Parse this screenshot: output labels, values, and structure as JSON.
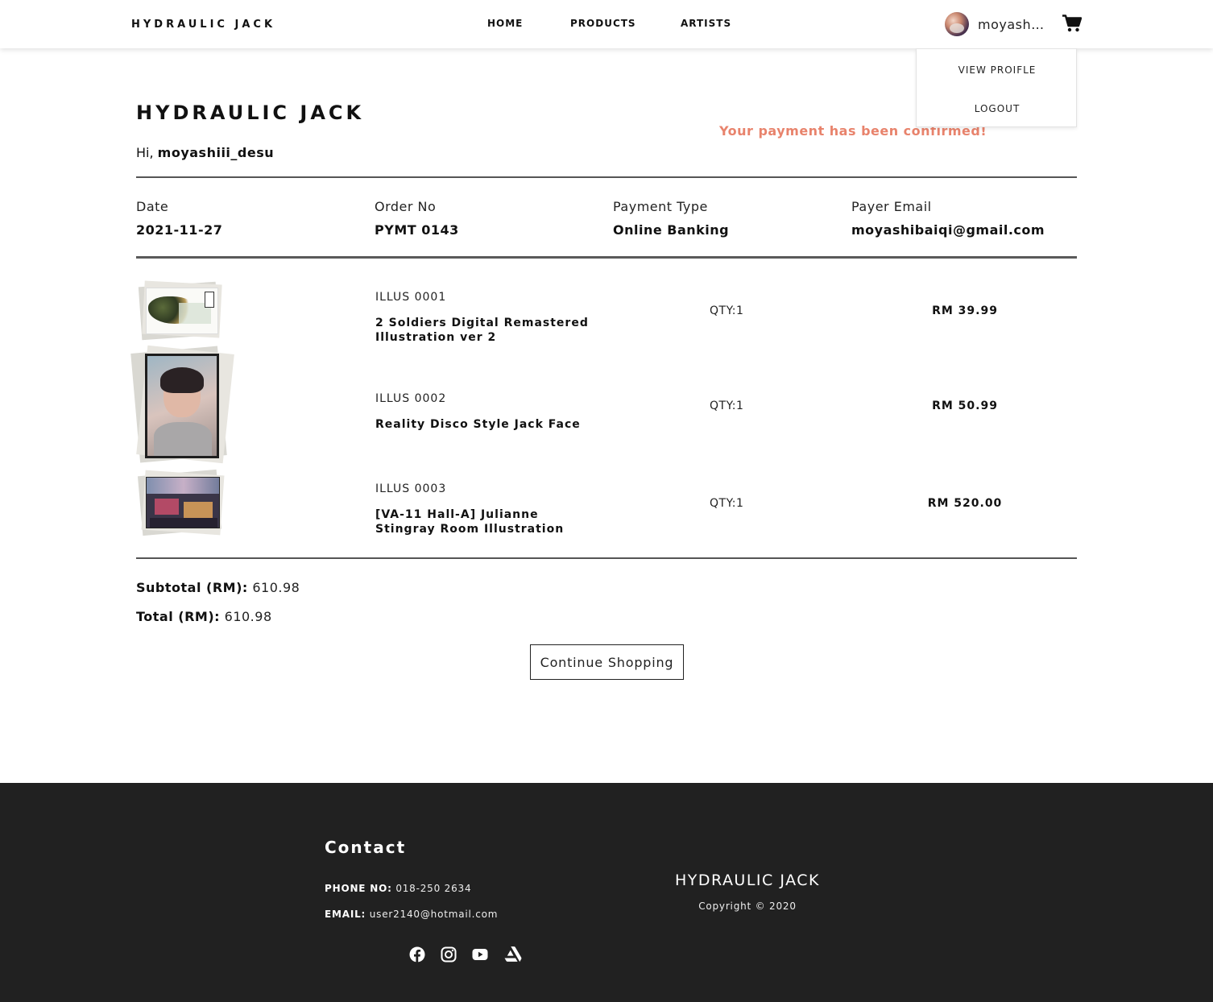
{
  "nav": {
    "brand": "HYDRAULIC JACK",
    "links": [
      "HOME",
      "PRODUCTS",
      "ARTISTS"
    ],
    "username": "moyashiii_desu",
    "cart_icon": "cart-icon",
    "avatar_icon": "user-avatar"
  },
  "dropdown": {
    "items": [
      "VIEW PROIFLE",
      "LOGOUT"
    ]
  },
  "receipt": {
    "brand": "HYDRAULIC JACK",
    "greeting_prefix": "Hi, ",
    "greeting_name": "moyashiii_desu",
    "confirmation": "Your payment has been confirmed!",
    "confirmation_color": "#e8836c",
    "info": [
      {
        "label": "Date",
        "value": "2021-11-27"
      },
      {
        "label": "Order No",
        "value": "PYMT 0143"
      },
      {
        "label": "Payment Type",
        "value": "Online Banking"
      },
      {
        "label": "Payer Email",
        "value": "moyashibaiqi@gmail.com"
      }
    ],
    "items": [
      {
        "code": "ILLUS 0001",
        "name": "2 Soldiers Digital Remastered Illustration ver 2",
        "qty": "QTY:1",
        "price": "RM 39.99"
      },
      {
        "code": "ILLUS 0002",
        "name": "Reality Disco Style Jack Face",
        "qty": "QTY:1",
        "price": "RM 50.99"
      },
      {
        "code": "ILLUS 0003",
        "name": "[VA-11 Hall-A] Julianne Stingray Room Illustration",
        "qty": "QTY:1",
        "price": "RM 520.00"
      }
    ],
    "subtotal_label": "Subtotal (RM):",
    "subtotal_value": " 610.98",
    "total_label": "Total (RM):",
    "total_value": " 610.98",
    "continue_label": "Continue Shopping"
  },
  "footer": {
    "contact_title": "Contact",
    "phone_label": "PHONE NO:",
    "phone_value": " 018-250 2634",
    "email_label": "EMAIL:",
    "email_value": " user2140@hotmail.com",
    "social_icons": [
      "facebook-icon",
      "instagram-icon",
      "youtube-icon",
      "artstation-icon"
    ],
    "brand": "HYDRAULIC JACK",
    "copyright": "Copyright © 2020",
    "background": "#212121"
  }
}
